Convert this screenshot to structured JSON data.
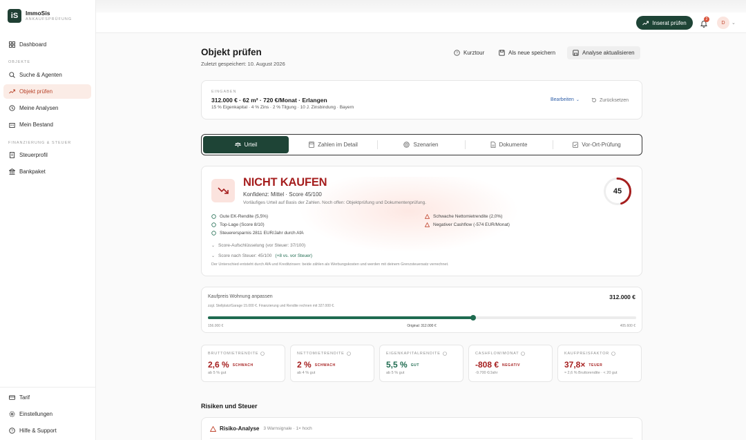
{
  "brand": {
    "mark": "iS",
    "name": "ImmoSis",
    "tagline": "ANKAUFSPRÜFUNG"
  },
  "sidebar": {
    "top_items": [
      {
        "label": "Dashboard",
        "icon": "grid-icon"
      }
    ],
    "section_objekte": "OBJEKTE",
    "objekte_items": [
      {
        "label": "Suche & Agenten",
        "icon": "search-icon"
      },
      {
        "label": "Objekt prüfen",
        "icon": "trend-icon",
        "active": true
      },
      {
        "label": "Meine Analysen",
        "icon": "history-icon"
      },
      {
        "label": "Mein Bestand",
        "icon": "building-icon"
      }
    ],
    "section_finanz": "FINANZIERUNG & STEUER",
    "finanz_items": [
      {
        "label": "Steuerprofil",
        "icon": "document-icon"
      },
      {
        "label": "Bankpaket",
        "icon": "bank-icon"
      }
    ],
    "bottom_items": [
      {
        "label": "Tarif",
        "icon": "card-icon"
      },
      {
        "label": "Einstellungen",
        "icon": "gear-icon"
      },
      {
        "label": "Hilfe & Support",
        "icon": "help-icon"
      }
    ]
  },
  "topbar": {
    "primary_button": "Inserat prüfen",
    "notification_count": "2",
    "avatar_initial": "D"
  },
  "page": {
    "title": "Objekt prüfen",
    "subtitle": "Zuletzt gespeichert: 10. August 2026",
    "actions": {
      "tour": "Kurztour",
      "save_new": "Als neue speichern",
      "update": "Analyse aktualisieren"
    }
  },
  "inputs": {
    "label": "EINGABEN",
    "main": "312.000 € · 62 m² · 720 €/Monat · Erlangen",
    "details": "15 % Eigenkapital · 4 % Zins · 2 % Tilgung · 10 J. Zinsbindung · Bayern",
    "edit": "Bearbeiten",
    "reset": "Zurücksetzen"
  },
  "tabs": [
    {
      "label": "Urteil",
      "icon": "scale-icon",
      "active": true
    },
    {
      "label": "Zahlen im Detail",
      "icon": "calculator-icon"
    },
    {
      "label": "Szenarien",
      "icon": "target-icon"
    },
    {
      "label": "Dokumente",
      "icon": "file-icon"
    },
    {
      "label": "Vor-Ort-Prüfung",
      "icon": "checklist-icon"
    }
  ],
  "verdict": {
    "headline": "NICHT KAUFEN",
    "confidence": "Konfidenz: Mittel · Score 45/100",
    "note": "Vorläufiges Urteil auf Basis der Zahlen. Noch offen: Objektprüfung und Dokumentenprüfung.",
    "score": 45,
    "score_label": "45",
    "pros": [
      "Gute EK-Rendite (5,5%)",
      "Top-Lage (Score 8/10)",
      "Steuerersparnis 2811 EUR/Jahr durch AfA"
    ],
    "cons": [
      "Schwache Nettomietrendite (2,0%)",
      "Negativer Cashflow (-574 EUR/Monat)"
    ],
    "breakdown": "Score-Aufschlüsselung (vor Steuer: 37/100)",
    "after_tax": "Score nach Steuer: 45/100",
    "after_tax_delta": "(+8 vs. vor Steuer)",
    "explanation": "Der Unterschied entsteht durch AfA und Kreditzinsen: beide zählen als Werbungskosten und werden mit deinem Grenzsteuersatz verrechnet.",
    "accent_color": "#a51e1e"
  },
  "slider": {
    "title": "Kaufpreis Wohnung anpassen",
    "value": "312.000 €",
    "note": "zzgl. Stellplatz/Garage 15.000 €. Finanzierung und Rendite rechnen mit 327.000 €.",
    "min_label": "156.000 €",
    "mid_label": "Original: 312.000 €",
    "max_label": "405.600 €",
    "position_fraction": 0.62,
    "color": "#1f6b50"
  },
  "metrics": [
    {
      "label": "BRUTTOMIETRENDITE",
      "value": "2,6 %",
      "tag": "SCHWACH",
      "sub": "ab 5 % gut",
      "tone": "red"
    },
    {
      "label": "NETTOMIETRENDITE",
      "value": "2 %",
      "tag": "SCHWACH",
      "sub": "ab 4 % gut",
      "tone": "red"
    },
    {
      "label": "EIGENKAPITALRENDITE",
      "value": "5,5 %",
      "tag": "GUT",
      "sub": "ab 5 % gut",
      "tone": "green"
    },
    {
      "label": "CASHFLOW/MONAT",
      "value": "-808 €",
      "tag": "NEGATIV",
      "sub": "-9.700 €/Jahr",
      "tone": "red"
    },
    {
      "label": "KAUFPREISFAKTOR",
      "value": "37,8×",
      "tag": "TEUER",
      "sub": "≈ 2,6 % Bruttorendite · < 20 gut",
      "tone": "red"
    }
  ],
  "risks": {
    "section_title": "Risiken und Steuer",
    "card_title": "Risiko-Analyse",
    "card_meta": "3 Warnsignale · 1× hoch"
  }
}
